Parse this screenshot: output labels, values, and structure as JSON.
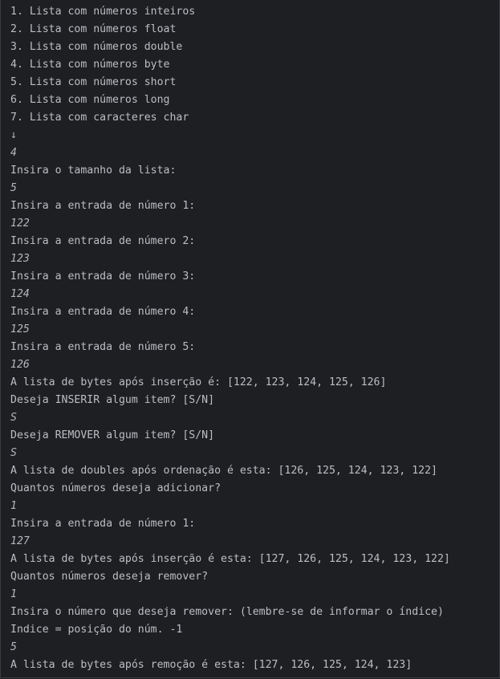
{
  "console": {
    "lines": [
      {
        "kind": "output",
        "text": "1. Lista com números inteiros"
      },
      {
        "kind": "output",
        "text": "2. Lista com números float"
      },
      {
        "kind": "output",
        "text": "3. Lista com números double"
      },
      {
        "kind": "output",
        "text": "4. Lista com números byte"
      },
      {
        "kind": "output",
        "text": "5. Lista com números short"
      },
      {
        "kind": "output",
        "text": "6. Lista com números long"
      },
      {
        "kind": "output",
        "text": "7. Lista com caracteres char"
      },
      {
        "kind": "arrow",
        "text": "↓"
      },
      {
        "kind": "input",
        "text": "4"
      },
      {
        "kind": "output",
        "text": "Insira o tamanho da lista:"
      },
      {
        "kind": "input",
        "text": "5"
      },
      {
        "kind": "output",
        "text": "Insira a entrada de número 1:"
      },
      {
        "kind": "input",
        "text": "122"
      },
      {
        "kind": "output",
        "text": "Insira a entrada de número 2:"
      },
      {
        "kind": "input",
        "text": "123"
      },
      {
        "kind": "output",
        "text": "Insira a entrada de número 3:"
      },
      {
        "kind": "input",
        "text": "124"
      },
      {
        "kind": "output",
        "text": "Insira a entrada de número 4:"
      },
      {
        "kind": "input",
        "text": "125"
      },
      {
        "kind": "output",
        "text": "Insira a entrada de número 5:"
      },
      {
        "kind": "input",
        "text": "126"
      },
      {
        "kind": "output",
        "text": "A lista de bytes após inserção é: [122, 123, 124, 125, 126]"
      },
      {
        "kind": "output",
        "text": "Deseja INSERIR algum item? [S/N]"
      },
      {
        "kind": "input",
        "text": "S"
      },
      {
        "kind": "output",
        "text": "Deseja REMOVER algum item? [S/N]"
      },
      {
        "kind": "input",
        "text": "S"
      },
      {
        "kind": "output",
        "text": "A lista de doubles após ordenação é esta: [126, 125, 124, 123, 122]"
      },
      {
        "kind": "output",
        "text": "Quantos números deseja adicionar?"
      },
      {
        "kind": "input",
        "text": "1"
      },
      {
        "kind": "output",
        "text": "Insira a entrada de número 1:"
      },
      {
        "kind": "input",
        "text": "127"
      },
      {
        "kind": "output",
        "text": "A lista de bytes após inserção é esta: [127, 126, 125, 124, 123, 122]"
      },
      {
        "kind": "output",
        "text": "Quantos números deseja remover?"
      },
      {
        "kind": "input",
        "text": "1"
      },
      {
        "kind": "output",
        "text": "Insira o número que deseja remover: (lembre-se de informar o índice)"
      },
      {
        "kind": "output",
        "text": "Indice = posição do núm. -1"
      },
      {
        "kind": "input",
        "text": "5"
      },
      {
        "kind": "output",
        "text": "A lista de bytes após remoção é esta: [127, 126, 125, 124, 123]"
      }
    ]
  },
  "colors": {
    "background": "#1e1f22",
    "output_text": "#bcbec4",
    "input_text": "#b4b6bc",
    "border": "#3b3d42"
  }
}
